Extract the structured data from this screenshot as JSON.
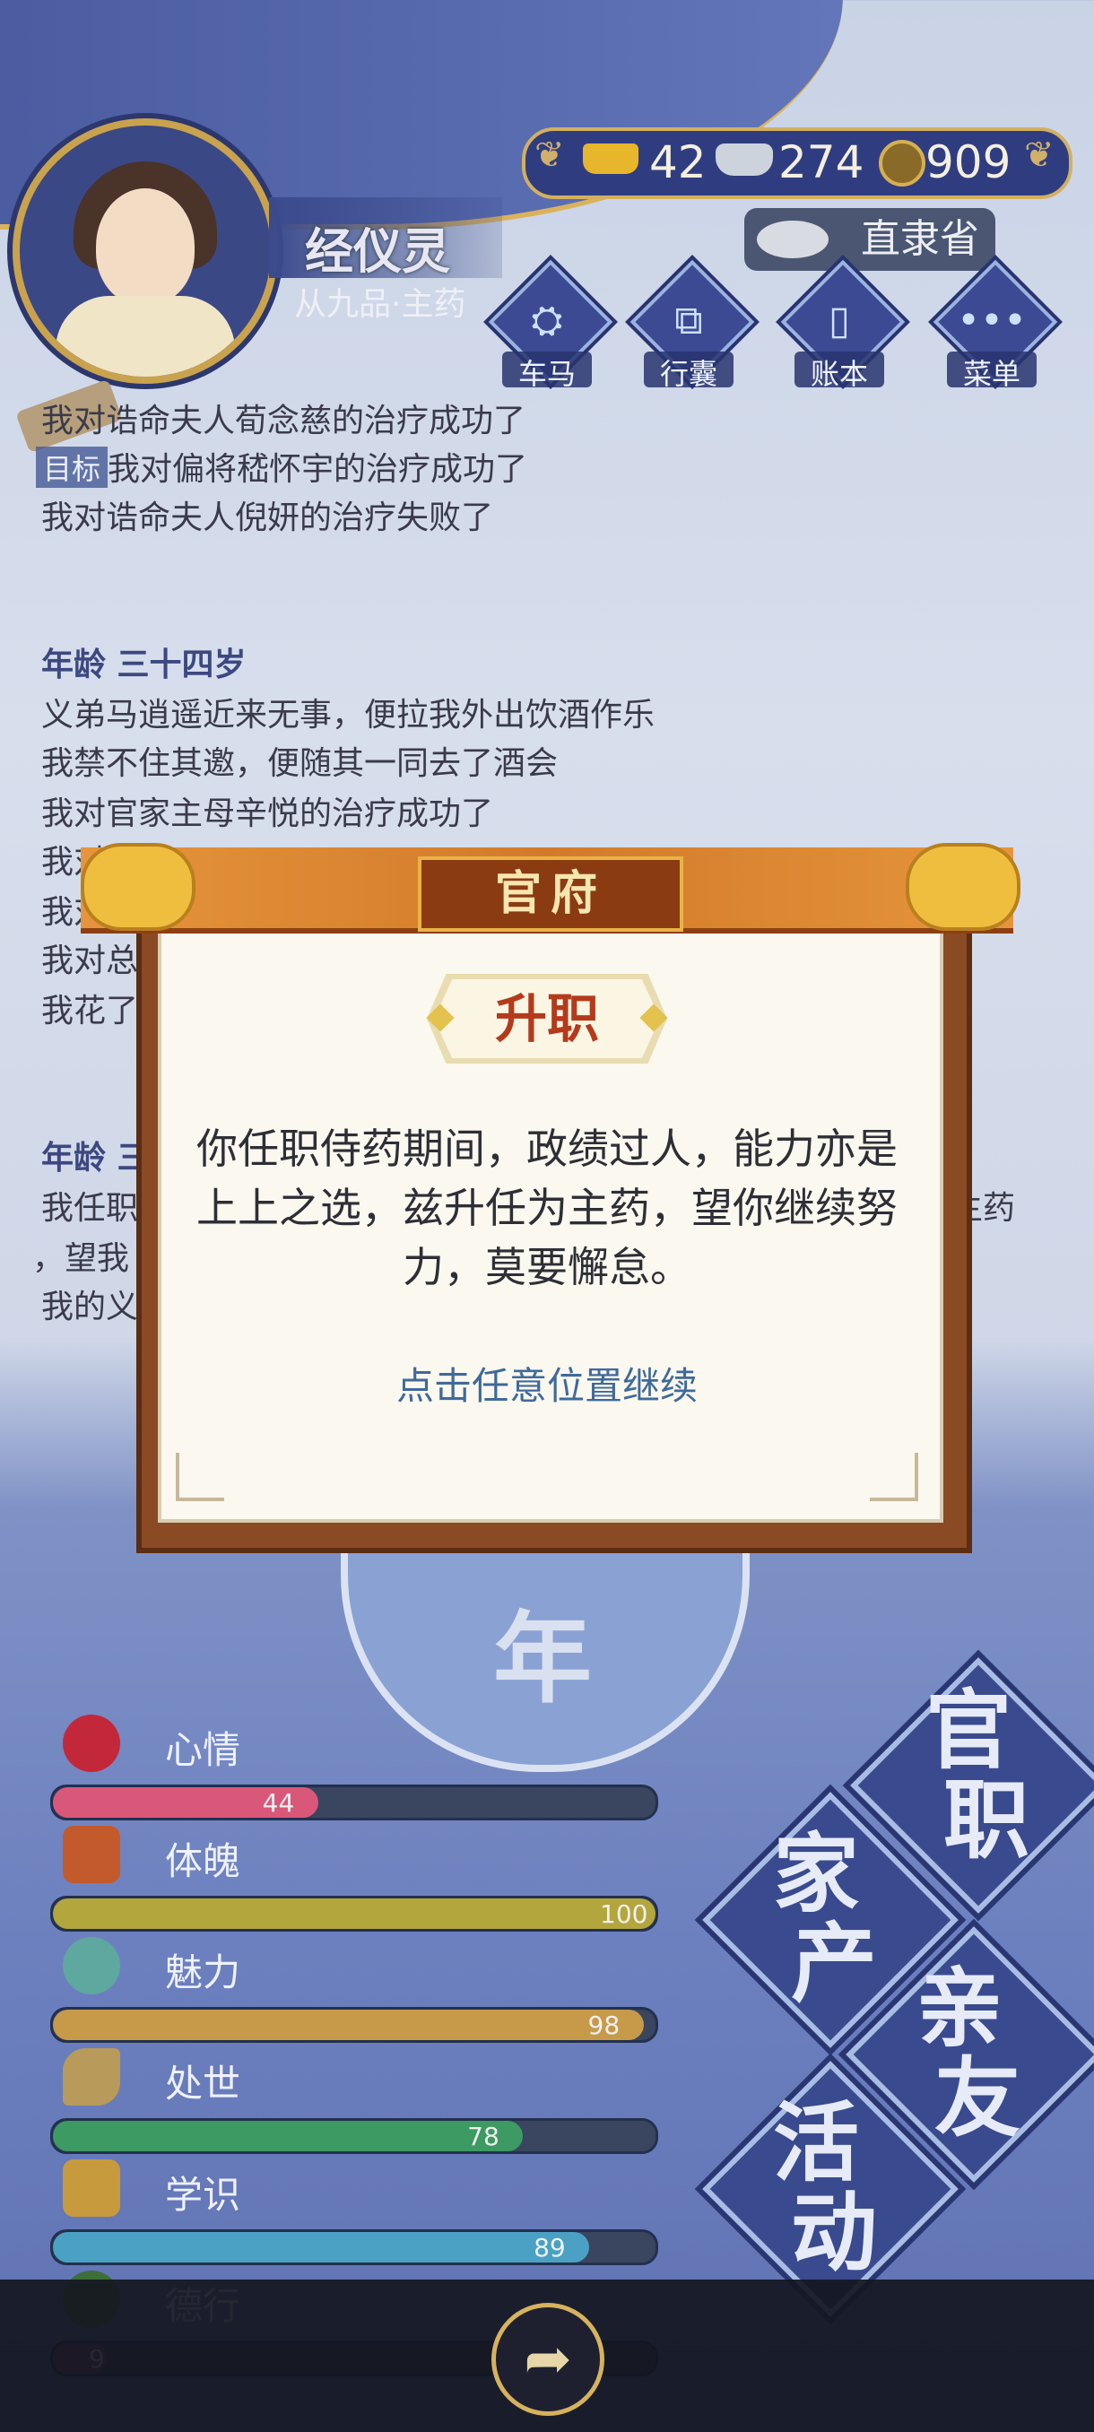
{
  "header": {
    "name": "经仪灵",
    "rank": "从九品·主药",
    "currency": {
      "gold": "42",
      "silver": "274",
      "coins": "909"
    },
    "province": "直隶省",
    "nav": [
      {
        "label": "车马",
        "glyph": "⛭"
      },
      {
        "label": "行囊",
        "glyph": "⧉"
      },
      {
        "label": "账本",
        "glyph": "▯"
      },
      {
        "label": "菜单",
        "glyph": "•••"
      }
    ],
    "goal_label": "目标"
  },
  "log": {
    "lines_top": [
      "我对诰命夫人荀念慈的治疗成功了",
      "我对偏将嵇怀宇的治疗成功了",
      "我对诰命夫人倪妍的治疗失败了"
    ],
    "age_heading": "年龄 三十四岁",
    "lines_age": [
      "义弟马逍遥近来无事，便拉我外出饮酒作乐",
      "我禁不住其邀，便随其一同去了酒会",
      "我对官家主母辛悦的治疗成功了",
      "我对",
      "我对官",
      "我对总",
      "我花了"
    ],
    "age_heading_2": "年龄 三",
    "lines_age2": [
      "我任职",
      "，望我",
      "我的义"
    ],
    "right_tail": "主药"
  },
  "stats": [
    {
      "label": "心情",
      "value": 44,
      "max": 100,
      "color": "#d9587a"
    },
    {
      "label": "体魄",
      "value": 100,
      "max": 100,
      "color": "#b3a63c"
    },
    {
      "label": "魅力",
      "value": 98,
      "max": 100,
      "color": "#c79a4a"
    },
    {
      "label": "处世",
      "value": 78,
      "max": 100,
      "color": "#3c9a62"
    },
    {
      "label": "学识",
      "value": 89,
      "max": 100,
      "color": "#4aa1c4"
    },
    {
      "label": "德行",
      "value": 9,
      "max": 100,
      "color": "#7a3a6e"
    }
  ],
  "year": "年",
  "actions": {
    "official": "官职",
    "property": "家产",
    "friends": "亲友",
    "activity": "活动"
  },
  "modal": {
    "banner": "官府",
    "subtitle": "升职",
    "body": "你任职侍药期间，政绩过人，能力亦是上上之选，兹升任为主药，望你继续努力，莫要懈怠。",
    "hint": "点击任意位置继续"
  }
}
